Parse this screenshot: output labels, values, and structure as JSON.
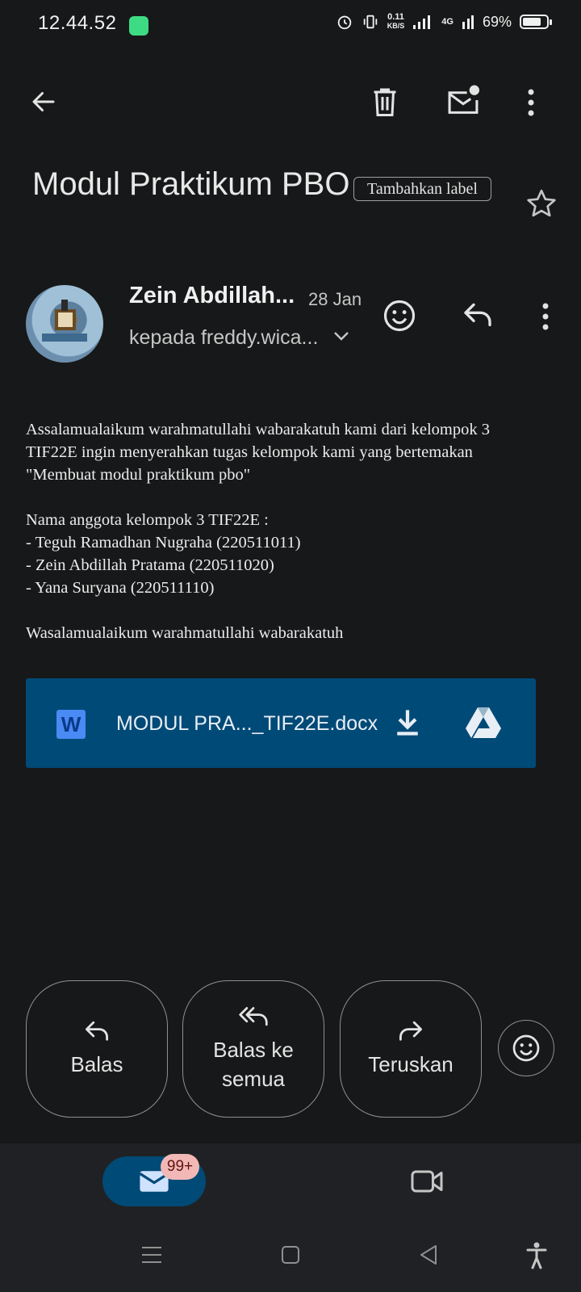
{
  "status_bar": {
    "time": "12.44.52",
    "speed_value": "0.11",
    "speed_unit": "KB/S",
    "network": "4G",
    "battery": "69%"
  },
  "toolbar": {
    "back": "arrow-left-icon",
    "delete": "trash-icon",
    "mark_unread": "mail-unread-icon",
    "more": "more-vert-icon"
  },
  "email": {
    "subject": "Modul Praktikum PBO",
    "label_chip": "Tambahkan label",
    "sender_name": "Zein Abdillah...",
    "date": "28 Jan",
    "recipient": "kepada freddy.wica...",
    "body": {
      "para1_line1": "Assalamualaikum warahmatullahi wabarakatuh kami dari kelompok 3",
      "para1_line2": "TIF22E ingin menyerahkan tugas kelompok kami yang bertemakan",
      "para1_line3": "\"Membuat modul praktikum pbo\"",
      "members_heading": "Nama anggota kelompok 3 TIF22E :",
      "member1": "- Teguh Ramadhan Nugraha (220511011)",
      "member2": "- Zein Abdillah Pratama (220511020)",
      "member3": "- Yana Suryana (220511110)",
      "closing": "Wasalamualaikum warahmatullahi wabarakatuh"
    },
    "attachment": {
      "icon_letter": "W",
      "filename": "MODUL PRA..._TIF22E.docx"
    }
  },
  "actions": {
    "reply": "Balas",
    "reply_all_line1": "Balas ke",
    "reply_all_line2": "semua",
    "forward": "Teruskan"
  },
  "bottom_nav": {
    "mail_badge": "99+"
  },
  "colors": {
    "background": "#171819",
    "attachment_bg": "#004a77",
    "badge_bg": "#f2b8b5"
  }
}
